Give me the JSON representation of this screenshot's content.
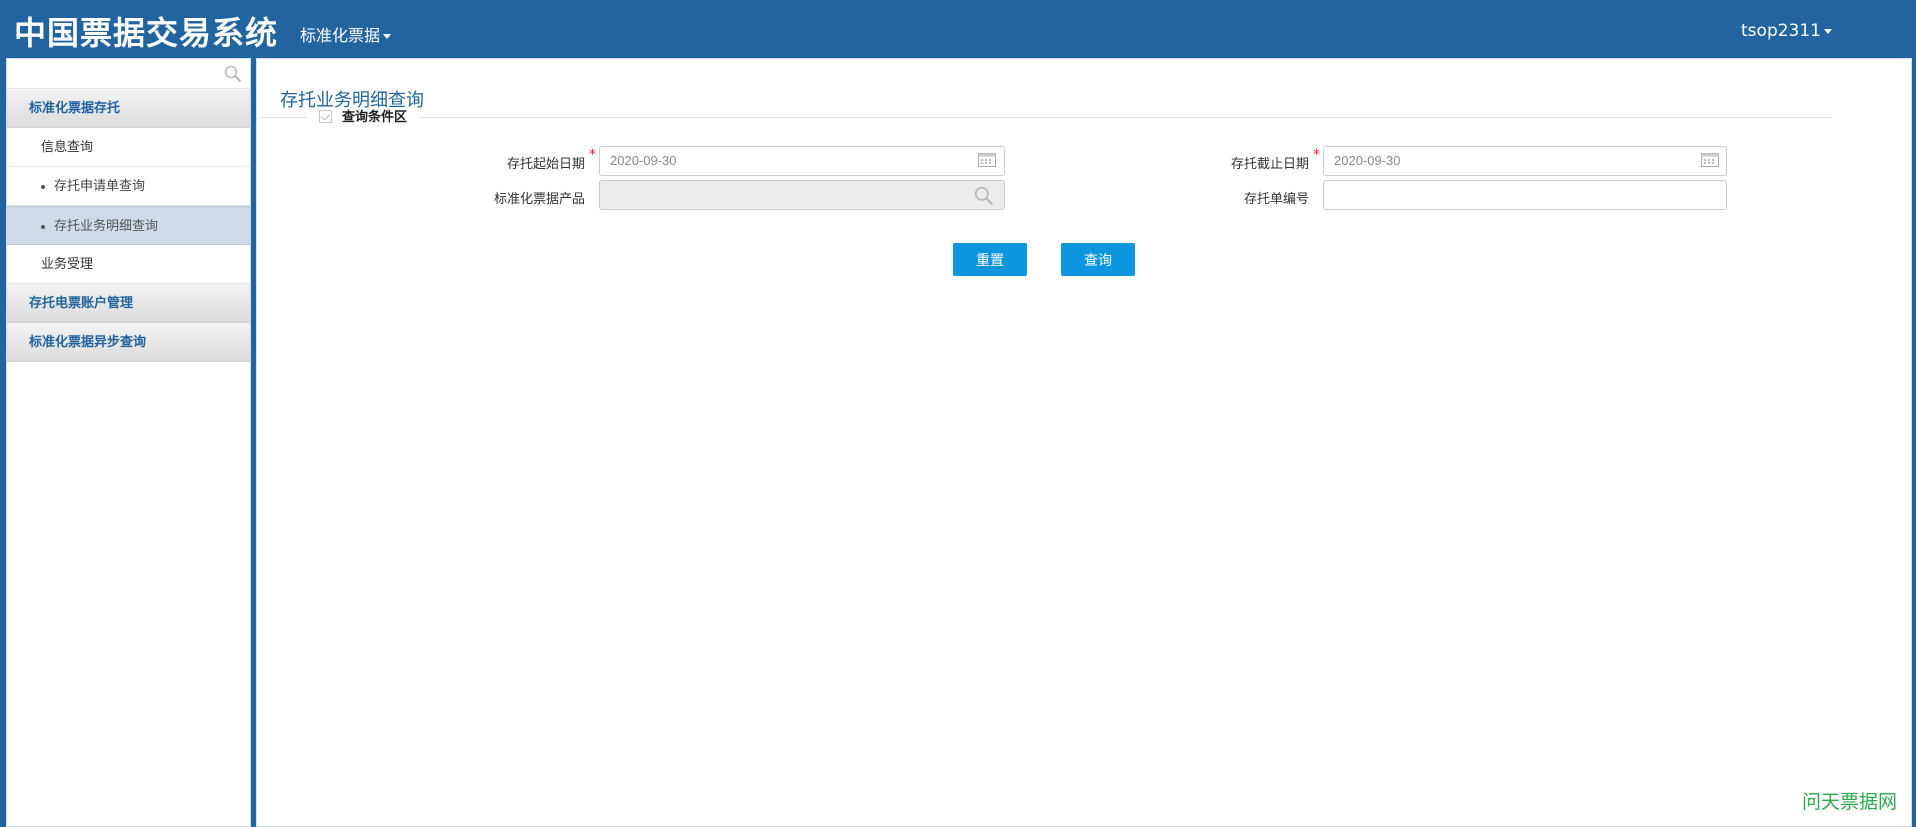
{
  "header": {
    "app_title": "中国票据交易系统",
    "nav_menu": "标准化票据",
    "user_menu": "tsop2311"
  },
  "sidebar": {
    "search_placeholder": "",
    "groups": [
      {
        "label": "标准化票据存托",
        "items": [
          {
            "label": "信息查询",
            "level": 1
          },
          {
            "label": "存托申请单查询",
            "level": 2
          },
          {
            "label": "存托业务明细查询",
            "level": 2,
            "active": true
          },
          {
            "label": "业务受理",
            "level": 1
          }
        ]
      },
      {
        "label": "存托电票账户管理"
      },
      {
        "label": "标准化票据异步查询"
      }
    ]
  },
  "main": {
    "page_title": "存托业务明细查询",
    "section_legend": "查询条件区",
    "form": {
      "start_date_label": "存托起始日期",
      "start_date_value": "2020-09-30",
      "end_date_label": "存托截止日期",
      "end_date_value": "2020-09-30",
      "product_label": "标准化票据产品",
      "product_value": "",
      "order_no_label": "存托单编号",
      "order_no_value": "",
      "required_mark": "*"
    },
    "buttons": {
      "reset": "重置",
      "query": "查询"
    }
  },
  "watermark": "问天票据网",
  "colors": {
    "header_bg": "#2264a0",
    "accent": "#2264a0",
    "button_bg": "#0d95e0",
    "required": "#e02020",
    "watermark": "#2fa84f"
  }
}
